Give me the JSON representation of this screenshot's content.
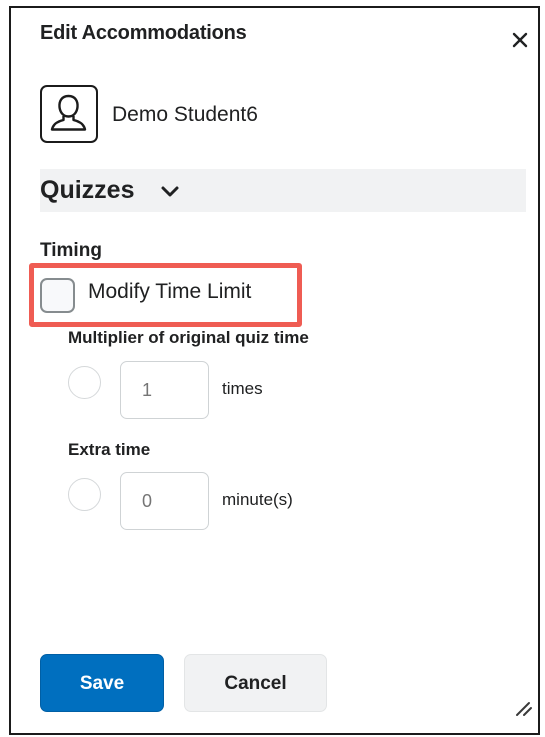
{
  "dialog": {
    "title": "Edit Accommodations",
    "close_icon": "close-icon"
  },
  "student": {
    "avatar_icon": "user-avatar-icon",
    "name": "Demo Student6"
  },
  "section": {
    "title": "Quizzes",
    "chevron_icon": "chevron-down-icon"
  },
  "timing": {
    "label": "Timing",
    "modify_time_limit": {
      "label": "Modify Time Limit",
      "checked": false
    },
    "multiplier": {
      "label": "Multiplier of original quiz time",
      "placeholder": "1",
      "value": "",
      "unit": "times",
      "selected": false
    },
    "extra_time": {
      "label": "Extra time",
      "placeholder": "0",
      "value": "",
      "unit": "minute(s)",
      "selected": false
    }
  },
  "actions": {
    "save_label": "Save",
    "cancel_label": "Cancel"
  },
  "colors": {
    "primary": "#006fbf",
    "highlight": "#ef5c53",
    "section_bg": "#f1f2f3"
  }
}
